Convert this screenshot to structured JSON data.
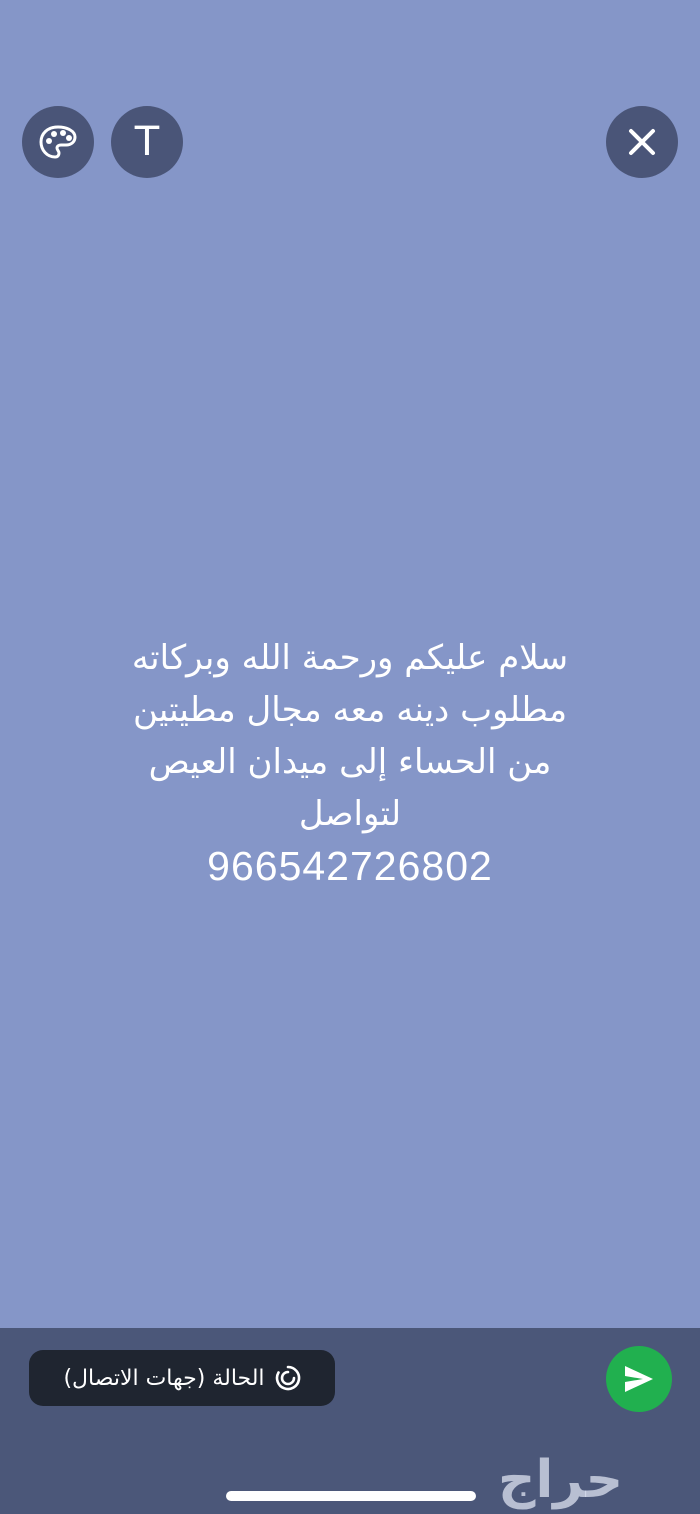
{
  "toolbar": {
    "palette_icon": "palette-icon",
    "text_tool_label": "T",
    "close_icon": "close-icon"
  },
  "message": {
    "lines": [
      "سلام عليكم ورحمة الله وبركاته",
      "مطلوب دينه معه مجال مطيتين",
      "من الحساء إلى ميدان العيص",
      "لتواصل",
      "966542726802"
    ]
  },
  "footer": {
    "audience_label": "الحالة (جهات الاتصال)",
    "audience_icon": "status-ring-icon",
    "send_icon": "send-icon",
    "watermark": "حراج"
  },
  "colors": {
    "background": "#8596c8",
    "button_bg": "#4a5578",
    "bottom_bar": "#4b5779",
    "pill_bg": "#1f2530",
    "send_green": "#21b04f"
  }
}
